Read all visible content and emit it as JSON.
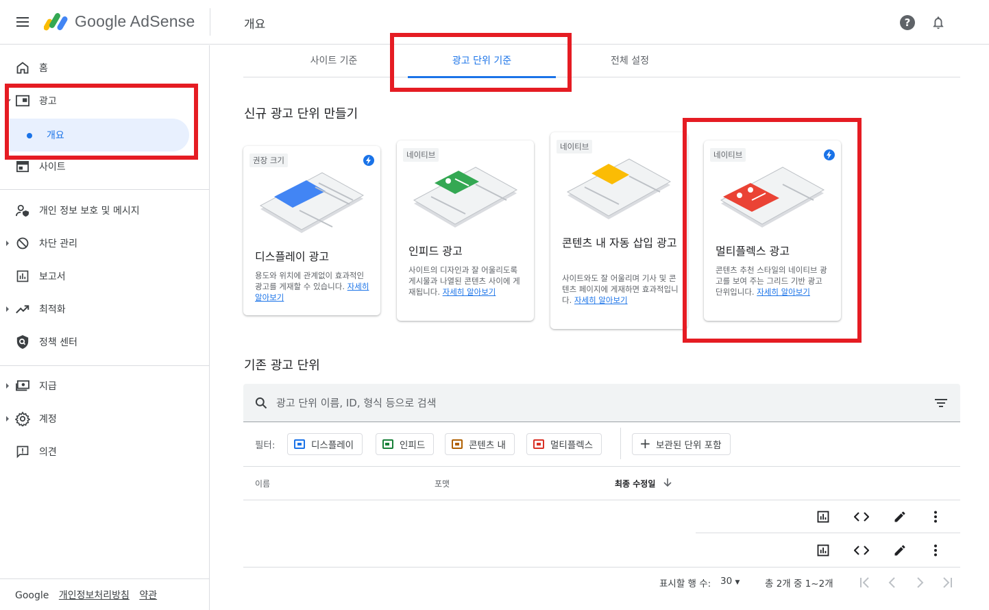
{
  "header": {
    "brand": "Google AdSense",
    "page_title": "개요"
  },
  "sidebar": {
    "items": [
      {
        "label": "홈"
      },
      {
        "label": "광고"
      },
      {
        "label": "개요"
      },
      {
        "label": "사이트"
      },
      {
        "label": "개인 정보 보호 및 메시지"
      },
      {
        "label": "차단 관리"
      },
      {
        "label": "보고서"
      },
      {
        "label": "최적화"
      },
      {
        "label": "정책 센터"
      },
      {
        "label": "지급"
      },
      {
        "label": "계정"
      },
      {
        "label": "의견"
      }
    ],
    "footer": {
      "google": "Google",
      "privacy": "개인정보처리방침",
      "terms": "약관"
    }
  },
  "tabs": [
    {
      "label": "사이트 기준"
    },
    {
      "label": "광고 단위 기준"
    },
    {
      "label": "전체 설정"
    }
  ],
  "new_section_title": "신규 광고 단위 만들기",
  "cards": [
    {
      "chip": "권장 크기",
      "title": "디스플레이 광고",
      "desc": "용도와 위치에 관계없이 효과적인 광고를 게재할 수 있습니다.",
      "link": "자세히 알아보기",
      "accent": "#4285f4"
    },
    {
      "chip": "네이티브",
      "title": "인피드 광고",
      "desc": "사이트의 디자인과 잘 어울리도록 게시물과 나열된 콘텐츠 사이에 게재됩니다.",
      "link": "자세히 알아보기",
      "accent": "#34a853"
    },
    {
      "chip": "네이티브",
      "title": "콘텐츠 내 자동 삽입 광고",
      "desc": "사이트와도 잘 어울리며 기사 및 콘텐츠 페이지에 게재하면 효과적입니다.",
      "link": "자세히 알아보기",
      "accent": "#fbbc04"
    },
    {
      "chip": "네이티브",
      "title": "멀티플렉스 광고",
      "desc": "콘텐츠 추천 스타일의 네이티브 광고를 보여 주는 그리드 기반 광고 단위입니다.",
      "link": "자세히 알아보기",
      "accent": "#ea4335"
    }
  ],
  "existing_section_title": "기존 광고 단위",
  "search": {
    "placeholder": "광고 단위 이름, ID, 형식 등으로 검색"
  },
  "filters": {
    "label": "필터:",
    "chips": [
      {
        "label": "디스플레이",
        "color": "#1a73e8"
      },
      {
        "label": "인피드",
        "color": "#188038"
      },
      {
        "label": "콘텐츠 내",
        "color": "#b06000"
      },
      {
        "label": "멀티플렉스",
        "color": "#d93025"
      }
    ],
    "archived": "보관된 단위 포함"
  },
  "table": {
    "columns": [
      "이름",
      "포맷",
      "최종 수정일"
    ],
    "row_count": 2
  },
  "pagination": {
    "rows_label": "표시할 행 수:",
    "rows_value": "30",
    "range": "총 2개 중 1~2개"
  }
}
